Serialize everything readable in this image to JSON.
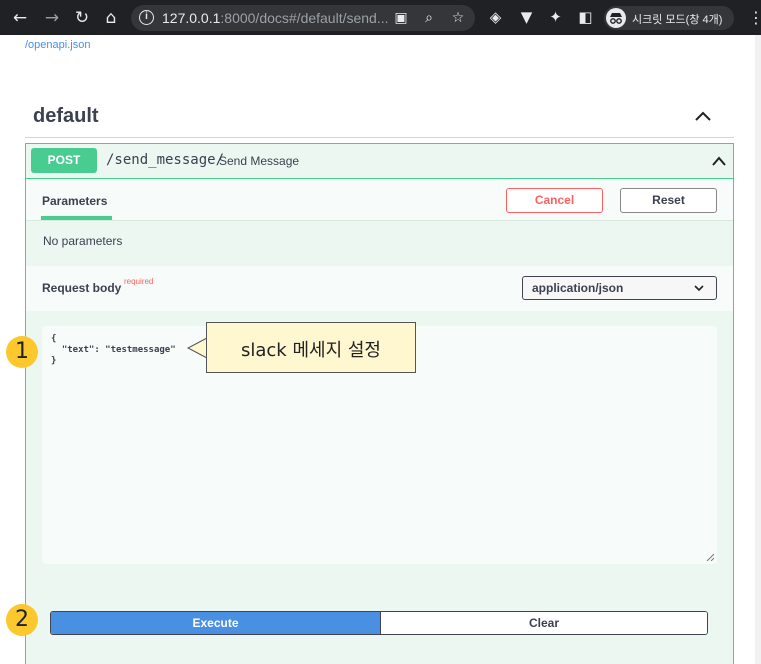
{
  "browser": {
    "url_host": "127.0.0.1",
    "url_rest": ":8000/docs#/default/send...",
    "profile_label": "시크릿 모드(창 4개)"
  },
  "page": {
    "openapi_link": "/openapi.json",
    "section_title": "default",
    "operation": {
      "method": "POST",
      "path": "/send_message/",
      "description": "Send Message",
      "tab_label": "Parameters",
      "cancel_label": "Cancel",
      "reset_label": "Reset",
      "no_params": "No parameters",
      "request_body_label": "Request body",
      "required_label": "required",
      "content_type": "application/json",
      "body_text": "{\n  \"text\": \"testmessage\"\n}",
      "execute_label": "Execute",
      "clear_label": "Clear"
    }
  },
  "annotations": {
    "callout": "slack 메세지 설정",
    "badge1": "1",
    "badge2": "2"
  },
  "colors": {
    "post": "#49cc90",
    "execute": "#4990e2",
    "cancel": "#ff6060",
    "badge": "#fcc82d"
  }
}
